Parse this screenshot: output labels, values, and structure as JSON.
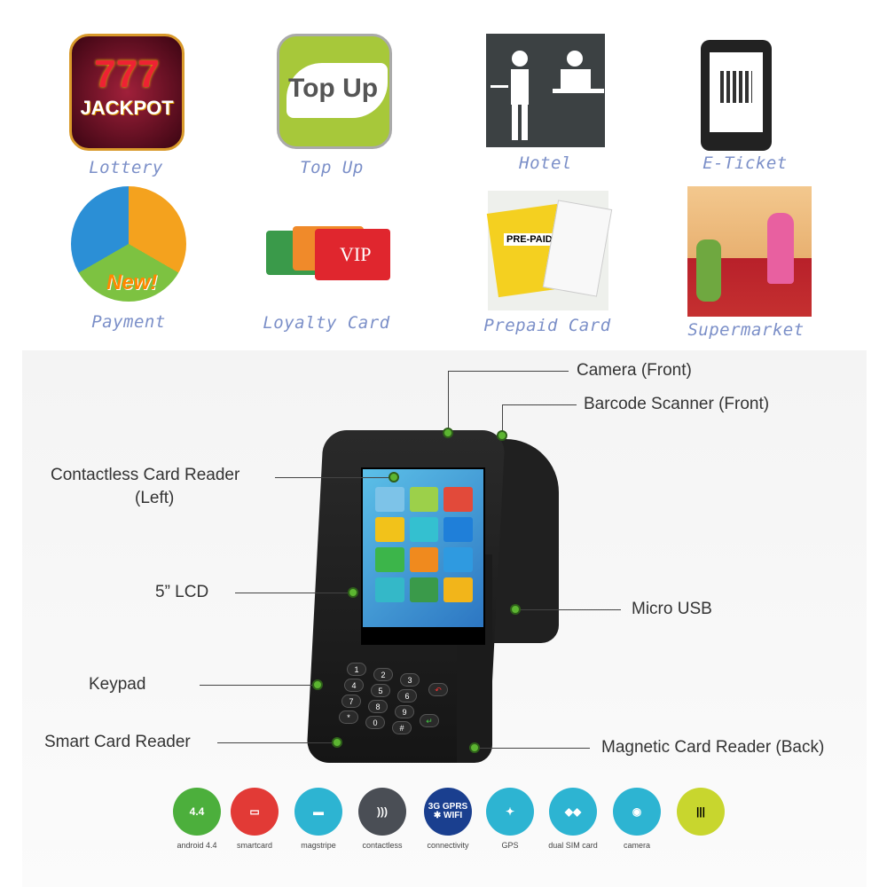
{
  "use_cases": [
    {
      "label": "Lottery",
      "art_text": "JACKPOT",
      "art_number": "777"
    },
    {
      "label": "Top Up",
      "art_text": "Top Up"
    },
    {
      "label": "Hotel"
    },
    {
      "label": "E-Ticket"
    },
    {
      "label": "Payment",
      "art_text": "New!"
    },
    {
      "label": "Loyalty Card",
      "art_text": "VIP"
    },
    {
      "label": "Prepaid Card",
      "art_text": "PRE-PAID"
    },
    {
      "label": "Supermarket"
    }
  ],
  "callouts": {
    "camera_front": "Camera (Front)",
    "barcode_front": "Barcode Scanner (Front)",
    "contactless_l1": "Contactless Card Reader",
    "contactless_l2": "(Left)",
    "lcd": "5” LCD",
    "micro_usb": "Micro USB",
    "keypad": "Keypad",
    "smart_card": "Smart Card Reader",
    "magnetic": "Magnetic Card Reader (Back)"
  },
  "keypad_keys": [
    "1",
    "2",
    "3",
    "4",
    "5",
    "6",
    "7",
    "8",
    "9",
    "*",
    "0",
    "#"
  ],
  "features": [
    {
      "label": "android 4.4",
      "icon": "android-icon",
      "glyph": "4.4",
      "color": "#4caf3c"
    },
    {
      "label": "smartcard",
      "icon": "smartcard-icon",
      "glyph": "▭",
      "color": "#e23a36"
    },
    {
      "label": "magstripe",
      "icon": "magstripe-icon",
      "glyph": "▬",
      "color": "#2db4d2"
    },
    {
      "label": "contactless",
      "icon": "contactless-icon",
      "glyph": ")))",
      "color": "#4a4e55"
    },
    {
      "label": "connectivity",
      "icon": "connectivity-icon",
      "glyph": "3G GPRS ✱ WIFI",
      "color": "#1a3f8f"
    },
    {
      "label": "GPS",
      "icon": "satellite-icon",
      "glyph": "✦",
      "color": "#2db4d2"
    },
    {
      "label": "dual SIM card",
      "icon": "sim-card-icon",
      "glyph": "◆◆",
      "color": "#2db4d2"
    },
    {
      "label": "camera",
      "icon": "camera-icon",
      "glyph": "◉",
      "color": "#2db4d2"
    },
    {
      "label": "",
      "icon": "barcode-icon",
      "glyph": "|||",
      "color": "#c8d62e"
    }
  ]
}
